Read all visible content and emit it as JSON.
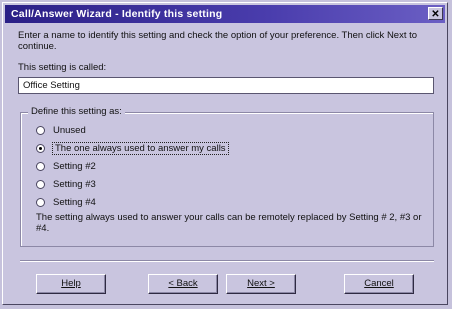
{
  "window": {
    "title": "Call/Answer Wizard - Identify this setting",
    "close_glyph": "✕"
  },
  "intro": "Enter a name to identify this setting and check the option of your preference. Then click Next to continue.",
  "name_field": {
    "label": "This setting is called:",
    "value": "Office Setting"
  },
  "group": {
    "legend": "Define this setting as:",
    "options": [
      {
        "label": "Unused",
        "selected": false
      },
      {
        "label": "The one always used to answer my calls",
        "selected": true
      },
      {
        "label": "Setting #2",
        "selected": false
      },
      {
        "label": "Setting #3",
        "selected": false
      },
      {
        "label": "Setting #4",
        "selected": false
      }
    ],
    "note": "The setting always used to answer your calls can be remotely replaced by Setting # 2, #3 or #4."
  },
  "buttons": {
    "help": "Help",
    "back": "< Back",
    "next": "Next >",
    "cancel": "Cancel"
  }
}
